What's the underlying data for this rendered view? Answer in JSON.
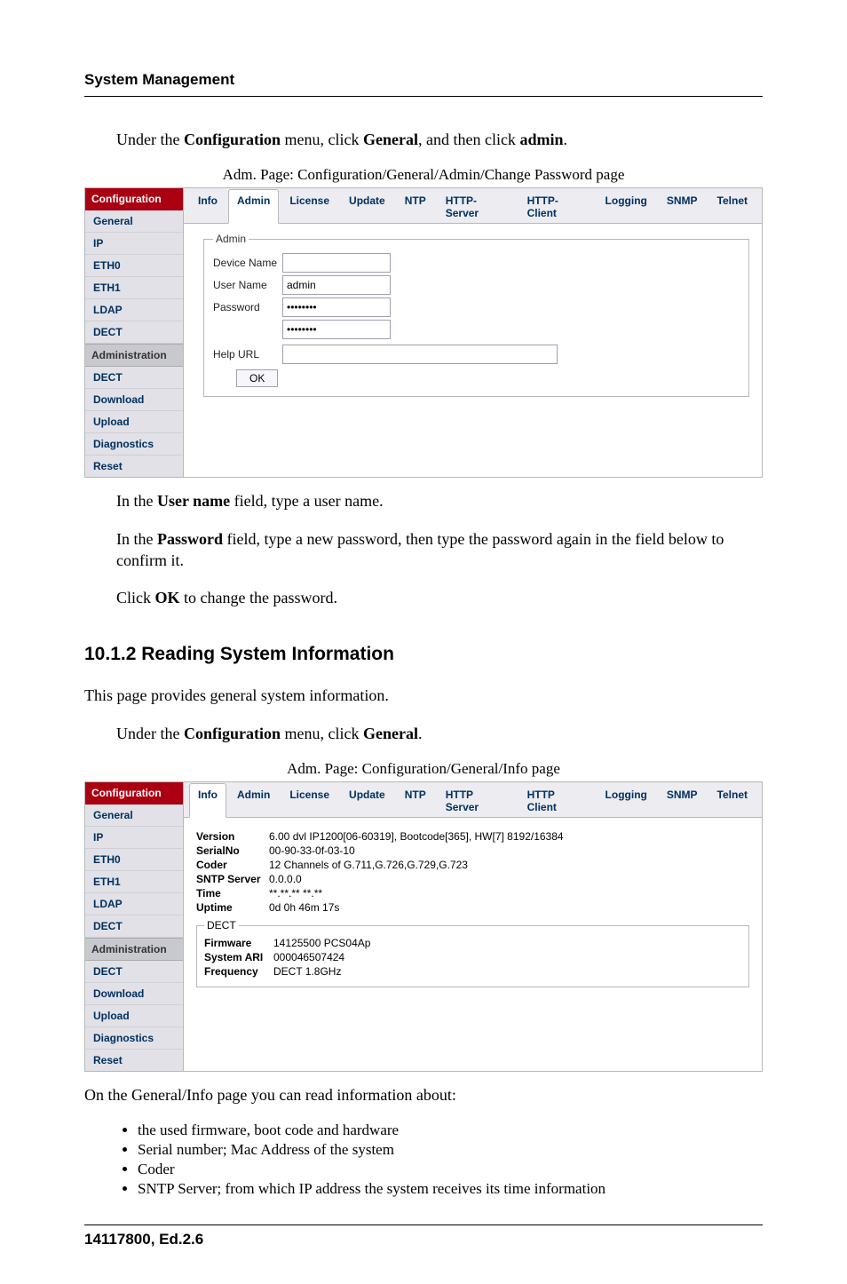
{
  "header": "System Management",
  "para1_pre": "Under the ",
  "para1_b1": "Configuration",
  "para1_mid1": " menu, click ",
  "para1_b2": "General",
  "para1_mid2": ", and then click ",
  "para1_b3": "admin",
  "para1_post": ".",
  "caption1": "Adm. Page: Configuration/General/Admin/Change Password page",
  "shot1": {
    "sidebar_head": "Configuration",
    "config_items": [
      "General",
      "IP",
      "ETH0",
      "ETH1",
      "LDAP",
      "DECT"
    ],
    "admin_head": "Administration",
    "admin_items": [
      "DECT",
      "Download",
      "Upload",
      "Diagnostics",
      "Reset"
    ],
    "tabs": [
      "Info",
      "Admin",
      "License",
      "Update",
      "NTP",
      "HTTP-Server",
      "HTTP-Client",
      "Logging",
      "SNMP",
      "Telnet"
    ],
    "active_tab": 1,
    "legend": "Admin",
    "labels": {
      "device_name": "Device Name",
      "user_name": "User Name",
      "password": "Password",
      "help_url": "Help URL"
    },
    "values": {
      "device_name": "",
      "user_name": "admin",
      "password": "••••••••",
      "password2": "••••••••",
      "help_url": ""
    },
    "ok": "OK"
  },
  "para2_pre": "In the ",
  "para2_b": "User name",
  "para2_post": " field, type a user name.",
  "para3_pre": "In the ",
  "para3_b": "Password",
  "para3_post": " field, type a new password, then type the password again in the field below to confirm it.",
  "para4_pre": "Click ",
  "para4_b": "OK",
  "para4_post": " to change the password.",
  "heading": "10.1.2  Reading System Information",
  "para5": "This page provides general system information.",
  "para6_pre": "Under the ",
  "para6_b1": "Configuration",
  "para6_mid": " menu, click ",
  "para6_b2": "General",
  "para6_post": ".",
  "caption2": "Adm. Page: Configuration/General/Info page",
  "shot2": {
    "sidebar_head": "Configuration",
    "config_items": [
      "General",
      "IP",
      "ETH0",
      "ETH1",
      "LDAP",
      "DECT"
    ],
    "admin_head": "Administration",
    "admin_items": [
      "DECT",
      "Download",
      "Upload",
      "Diagnostics",
      "Reset"
    ],
    "tabs": [
      "Info",
      "Admin",
      "License",
      "Update",
      "NTP",
      "HTTP Server",
      "HTTP Client",
      "Logging",
      "SNMP",
      "Telnet"
    ],
    "active_tab": 0,
    "rows": {
      "version_l": "Version",
      "version_v": "6.00 dvl IP1200[06-60319], Bootcode[365], HW[7] 8192/16384",
      "serial_l": "SerialNo",
      "serial_v": "00-90-33-0f-03-10",
      "coder_l": "Coder",
      "coder_v": "12 Channels of G.711,G.726,G.729,G.723",
      "sntp_l": "SNTP Server",
      "sntp_v": "0.0.0.0",
      "time_l": "Time",
      "time_v": "**.**.** **.**",
      "uptime_l": "Uptime",
      "uptime_v": "0d  0h 46m 17s"
    },
    "dect_legend": "DECT",
    "dect": {
      "firmware_l": "Firmware",
      "firmware_v": "14125500 PCS04Ap",
      "ari_l": "System ARI",
      "ari_v": "000046507424",
      "freq_l": "Frequency",
      "freq_v": "DECT 1.8GHz"
    }
  },
  "para7": "On the General/Info page you can read information about:",
  "bullets": [
    "the used firmware, boot code and hardware",
    "Serial number; Mac Address of the system",
    "Coder",
    "SNTP Server; from which IP address the system receives its time information"
  ],
  "footer": "14117800, Ed.2.6"
}
